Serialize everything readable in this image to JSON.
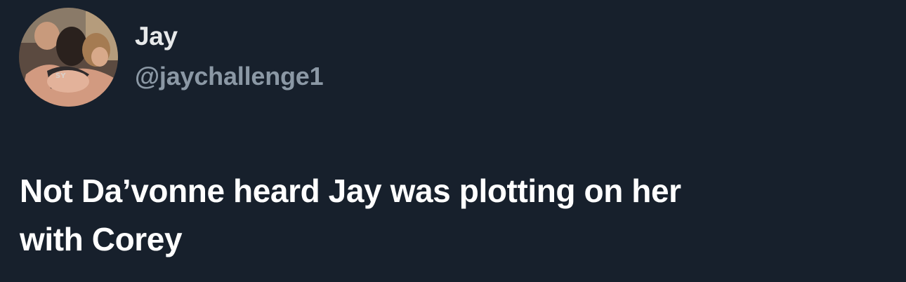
{
  "tweet": {
    "author": {
      "display_name": "Jay",
      "handle": "@jaychallenge1",
      "avatar_icon": "profile-photo"
    },
    "text": "Not Da’vonne heard Jay was plotting on her\nwith Corey"
  },
  "colors": {
    "background": "#17202c",
    "name": "#e7e9ea",
    "handle": "#8b98a5",
    "text": "#ffffff"
  }
}
